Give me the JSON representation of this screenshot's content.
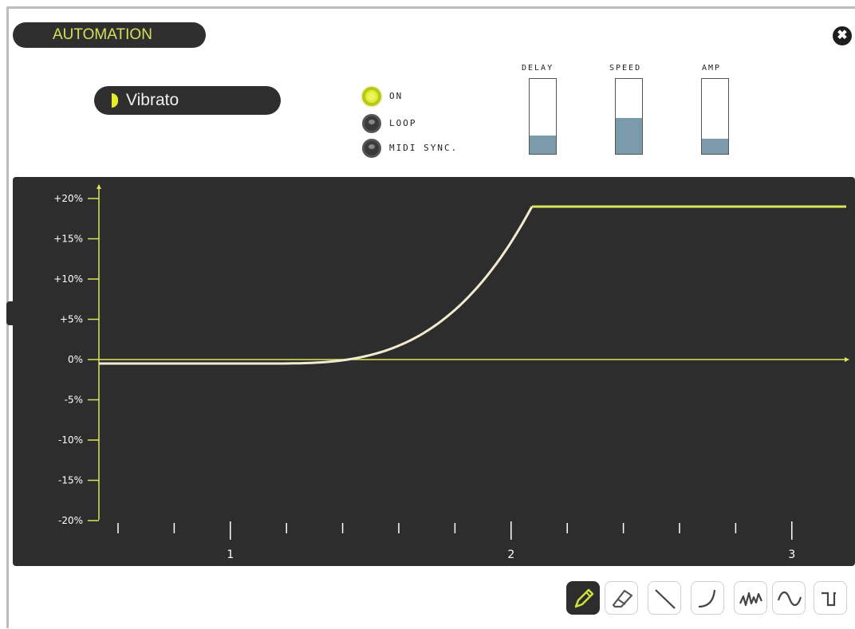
{
  "panel": {
    "title": "AUTOMATION",
    "close_glyph": "✖"
  },
  "preset": {
    "label": "Vibrato"
  },
  "options": [
    {
      "label": "ON",
      "state": "on"
    },
    {
      "label": "LOOP",
      "state": "off"
    },
    {
      "label": "MIDI SYNC.",
      "state": "off"
    }
  ],
  "sliders": [
    {
      "label": "DELAY",
      "level": 0.24
    },
    {
      "label": "SPEED",
      "level": 0.48
    },
    {
      "label": "AMP",
      "level": 0.2
    }
  ],
  "graph": {
    "y_ticks": [
      "+20%",
      "+15%",
      "+10%",
      "+5%",
      "0%",
      "-5%",
      "-10%",
      "-15%",
      "-20%"
    ],
    "x_labels": [
      "1",
      "2",
      "3"
    ],
    "colors": {
      "axis": "#d9e65a",
      "curve": "#f1ecd0",
      "flat": "#d9e65a",
      "background": "#2d2d2d"
    }
  },
  "tools": [
    {
      "name": "pencil-icon",
      "active": true
    },
    {
      "name": "eraser-icon",
      "active": false
    },
    {
      "name": "line-icon",
      "active": false
    },
    {
      "name": "curve-icon",
      "active": false
    },
    {
      "name": "random-icon",
      "active": false
    },
    {
      "name": "sine-icon",
      "active": false
    },
    {
      "name": "square-icon",
      "active": false
    }
  ]
}
